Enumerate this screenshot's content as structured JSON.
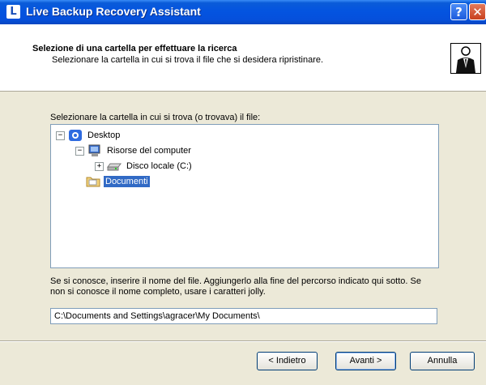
{
  "window": {
    "title": "Live Backup Recovery Assistant",
    "app_icon_glyph": "L",
    "help_glyph": "?",
    "close_glyph": "✕"
  },
  "header": {
    "title": "Selezione di una cartella per effettuare la ricerca",
    "subtitle": "Selezionare la cartella in cui si trova il file che si desidera ripristinare."
  },
  "tree": {
    "label": "Selezionare la cartella in cui si trova (o trovava) il file:",
    "items": [
      {
        "label": "Desktop",
        "icon": "desktop-icon",
        "expander": "−"
      },
      {
        "label": "Risorse del computer",
        "icon": "computer-icon",
        "expander": "−"
      },
      {
        "label": "Disco locale (C:)",
        "icon": "drive-icon",
        "expander": "+"
      },
      {
        "label": "Documenti",
        "icon": "folder-icon",
        "selected": true
      }
    ]
  },
  "filename": {
    "instructions": "Se si conosce, inserire il nome del file. Aggiungerlo alla fine del percorso indicato qui sotto. Se non si conosce il nome completo, usare i caratteri jolly.",
    "path_value": "C:\\Documents and Settings\\agracer\\My Documents\\"
  },
  "buttons": {
    "back": "< Indietro",
    "next": "Avanti >",
    "cancel": "Annulla"
  }
}
